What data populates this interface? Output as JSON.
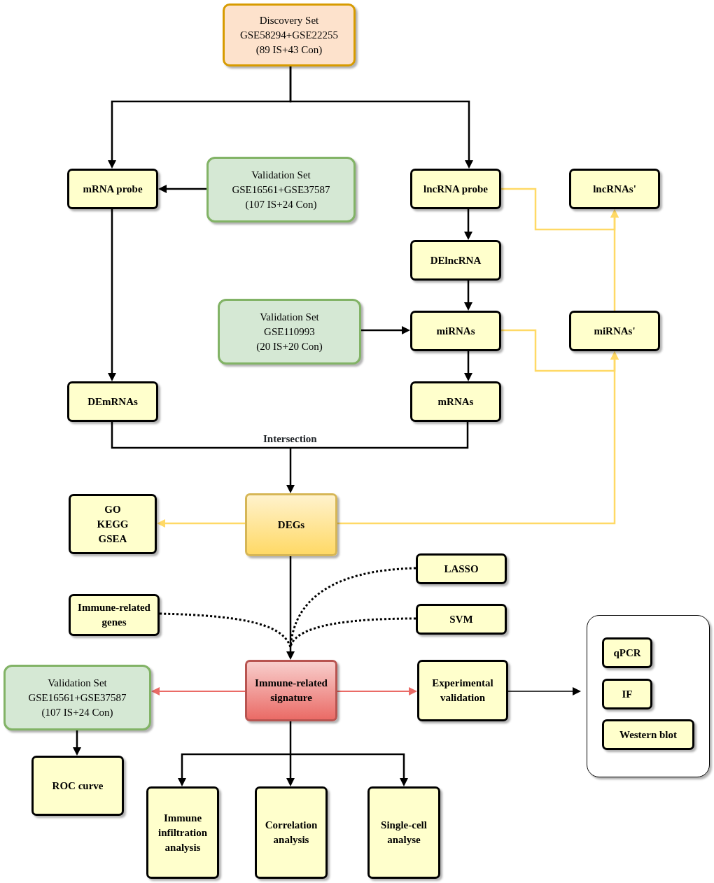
{
  "nodes": [
    {
      "kind": "dataset",
      "lines": [
        "Discovery Set",
        "GSE58294+GSE22255",
        "(89 IS+43 Con)"
      ]
    },
    {
      "kind": "process",
      "lines": [
        "mRNA probe"
      ]
    },
    {
      "kind": "validation",
      "lines": [
        "Validation Set",
        "GSE16561+GSE37587",
        "(107 IS+24 Con)"
      ]
    },
    {
      "kind": "process",
      "lines": [
        "lncRNA probe"
      ]
    },
    {
      "kind": "process",
      "lines": [
        "lncRNAs'"
      ]
    },
    {
      "kind": "process",
      "lines": [
        "DElncRNA"
      ]
    },
    {
      "kind": "validation",
      "lines": [
        "Validation Set",
        "GSE110993",
        "(20 IS+20 Con)"
      ]
    },
    {
      "kind": "process",
      "lines": [
        "miRNAs"
      ]
    },
    {
      "kind": "process",
      "lines": [
        "miRNAs'"
      ]
    },
    {
      "kind": "process",
      "lines": [
        "DEmRNAs"
      ]
    },
    {
      "kind": "process",
      "lines": [
        "mRNAs"
      ]
    },
    {
      "kind": "result",
      "lines": [
        "DEGs"
      ]
    },
    {
      "kind": "process",
      "lines": [
        "GO",
        "KEGG",
        "GSEA"
      ]
    },
    {
      "kind": "process",
      "lines": [
        "LASSO"
      ]
    },
    {
      "kind": "process",
      "lines": [
        "Immune-related",
        "genes"
      ]
    },
    {
      "kind": "process",
      "lines": [
        "SVM"
      ]
    },
    {
      "kind": "validation",
      "lines": [
        "Validation Set",
        "GSE16561+GSE37587",
        "(107 IS+24 Con)"
      ]
    },
    {
      "kind": "signature",
      "lines": [
        "Immune-related",
        "signature"
      ]
    },
    {
      "kind": "process",
      "lines": [
        "Experimental",
        "validation"
      ]
    },
    {
      "kind": "process",
      "lines": [
        "qPCR"
      ]
    },
    {
      "kind": "process",
      "lines": [
        "IF"
      ]
    },
    {
      "kind": "process",
      "lines": [
        "Western blot"
      ]
    },
    {
      "kind": "process",
      "lines": [
        "ROC curve"
      ]
    },
    {
      "kind": "process",
      "lines": [
        "Immune",
        "infiltration",
        "analysis"
      ]
    },
    {
      "kind": "process",
      "lines": [
        "Correlation",
        "analysis"
      ]
    },
    {
      "kind": "process",
      "lines": [
        "Single-cell",
        "analyse"
      ]
    }
  ],
  "edge_label": "Intersection"
}
